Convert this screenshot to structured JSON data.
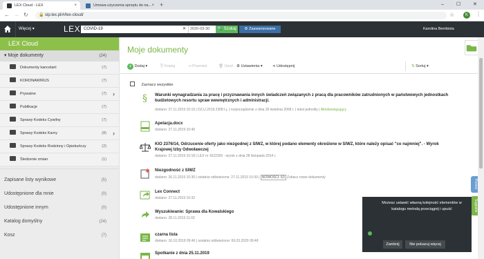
{
  "browser": {
    "tabs": [
      {
        "title": "LEX Cloud - LEX",
        "close": "×"
      },
      {
        "title": "Umowa użyczenia sprzętu do na...",
        "close": "×"
      }
    ],
    "new_tab": "+",
    "window_controls": [
      "–",
      "☐",
      "✕"
    ],
    "url": "sip.lex.pl/#/lex-cloud/",
    "colors": {
      "lex_favicon": "#2b3135",
      "umowa_favicon": "#3a6ea5"
    }
  },
  "appbar": {
    "more_label": "Więcej",
    "logo": "LEX",
    "search_value": "COVID-19",
    "date_value": "2020-03-30",
    "search_button": "Szukaj",
    "advanced_button": "Zaawansowane",
    "user_name": "Karolina Bembista"
  },
  "sidebar": {
    "header": "LEX Cloud",
    "my_docs": {
      "label": "Moje dokumenty",
      "count": "(24)"
    },
    "folders": [
      {
        "label": "Dokumenty kancelarii",
        "count": "(7)",
        "arrow": ""
      },
      {
        "label": "KORONAWIRUS",
        "count": "(7)",
        "arrow": ""
      },
      {
        "label": "Prywatne",
        "count": "(7)",
        "arrow": "›"
      },
      {
        "label": "Publikacje",
        "count": "(7)",
        "arrow": ""
      },
      {
        "label": "Sprawy Kodeks Cywilny",
        "count": "(7)",
        "arrow": ""
      },
      {
        "label": "Sprawy Kodeks Karny",
        "count": "(8)",
        "arrow": "›"
      },
      {
        "label": "Sprawy Kodeks Rodzinny i Opiekuńczy",
        "count": "(2)",
        "arrow": ""
      },
      {
        "label": "Śledzenie zmian",
        "count": "(1)",
        "arrow": ""
      }
    ],
    "sections": [
      {
        "label": "Zapisane listy wynikowe",
        "count": "(5)"
      },
      {
        "label": "Udostępnione dla mnie",
        "count": "(0)"
      },
      {
        "label": "Udostępnione innym",
        "count": "(0)"
      },
      {
        "label": "Katalog domyślny",
        "count": "(24)"
      },
      {
        "label": "Kosz",
        "count": "(7)"
      }
    ]
  },
  "main": {
    "title": "Moje dokumenty",
    "toolbar": {
      "add": "Dodaj",
      "copy": "Kopiuj",
      "move": "Przenieś",
      "delete": "Usuń",
      "settings": "Ustawienia",
      "share": "Udostępnij",
      "sort": "Sortuj"
    },
    "select_all": "Zaznacz wszystkie",
    "documents": [
      {
        "title": "Warunki wynagradzania za pracę i przyznawania innych świadczeń związanych z pracą dla pracowników zatrudnionych w państwowych jednostkach budżetowych resortu spraw wewnętrznych i administracji.",
        "meta": "dodano: 27.11.2019 10:19 | DZ.U.2019.2308 t.j. | rozporządzenie z dnia 30 kwietnia 2008 r. | tekst jednolity |",
        "meta_status": "Aktobowiązujący"
      },
      {
        "title": "Apelacja.docx",
        "meta": "dodano: 27.11.2019 10:40"
      },
      {
        "title": "KIO 2376/14, Odrzucenie oferty jako niezgodnej z SIWZ, w której podano elementy określone w SIWZ, które należy opisać \"co najmniej\". - Wyrok Krajowej Izby Odwoławczej",
        "meta": "dodano: 27.11.2019 10:18 | LEX nr 1622355 - wyrok z dnia 28 listopada 2014 r."
      },
      {
        "title": "Niezgodność z SIWZ",
        "meta": "dodano: 26.11.2019 10:30 | ostatnio odświeżone: 27.11.2019 10:30 |",
        "tag": "NOWOŚCI: 63",
        "meta_link": "Zobacz nowe dokumenty"
      },
      {
        "title": "Lex Connect",
        "meta": "dodano: 27.11.2019 10:32"
      },
      {
        "title": "Wyszukiwanie: Sprawa dla Kowalskiego",
        "meta": "dodano: 28.11.2019 11:03"
      },
      {
        "title": "czarna lista",
        "meta": "dodano: 16.10.2019 09:46 | ostatnio odświeżone: 06.03.2020 09:48"
      },
      {
        "title": "Spotkanie z dnia 25.11.2019",
        "meta": ""
      }
    ]
  },
  "side_tabs": {
    "help": "Pomoc",
    "suggestions": "Sugestie"
  },
  "toast": {
    "message": "Możesz ustawić własną kolejność elementów w katalogu metodą przeciągnij i upuść",
    "close_button": "Zamknij",
    "dont_show_button": "Nie pokazuj więcej"
  }
}
